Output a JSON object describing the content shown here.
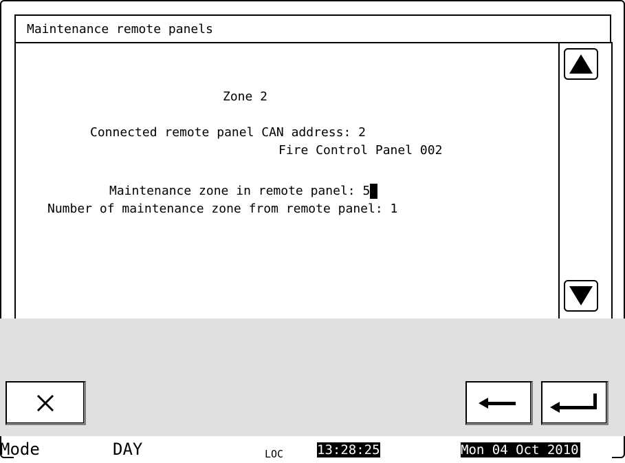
{
  "window": {
    "title": "Maintenance remote panels"
  },
  "content": {
    "zone_label": "Zone 2",
    "can_address_line": "Connected remote panel CAN address: 2",
    "panel_name": "Fire Control Panel 002",
    "maintenance_zone_label": "Maintenance zone in remote panel: 5",
    "number_of_zone_line": "Number of maintenance zone from remote panel: 1"
  },
  "scroll": {
    "up_icon": "triangle-up-icon",
    "down_icon": "triangle-down-icon"
  },
  "buttons": {
    "cancel_icon": "close-x-icon",
    "back_icon": "arrow-left-icon",
    "enter_icon": "enter-return-icon"
  },
  "status_bar": {
    "mode_label": "Mode",
    "mode_value": "DAY",
    "loc_label": "LOC",
    "time": "13:28:25",
    "date": "Mon 04 Oct 2010"
  }
}
